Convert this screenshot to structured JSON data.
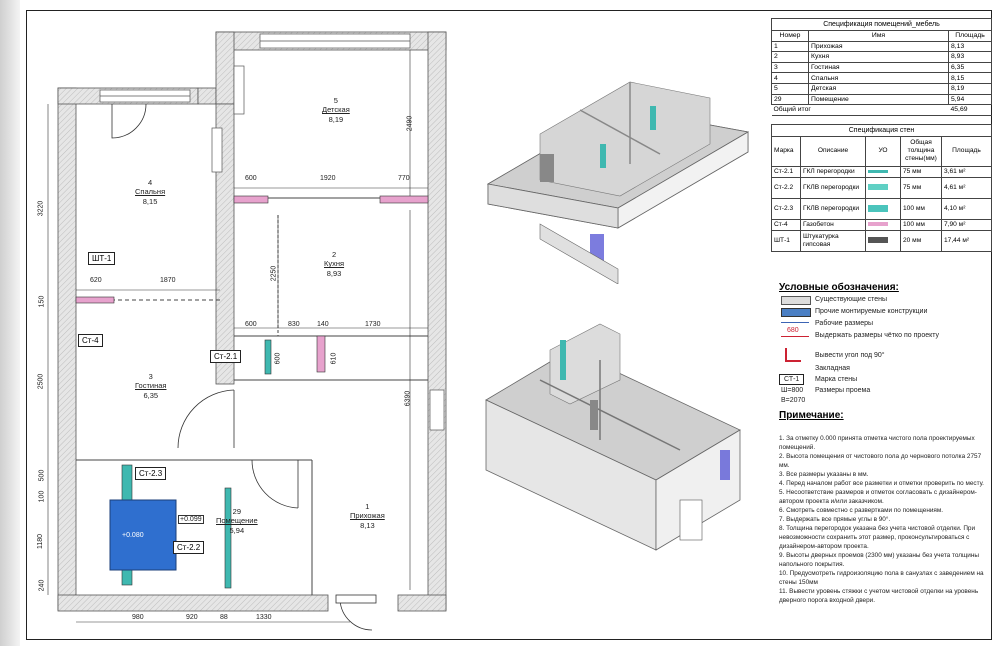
{
  "rooms": [
    {
      "num": "5",
      "name": "Детская",
      "area": "8,19"
    },
    {
      "num": "4",
      "name": "Спальня",
      "area": "8,15"
    },
    {
      "num": "2",
      "name": "Кухня",
      "area": "8,93"
    },
    {
      "num": "3",
      "name": "Гостиная",
      "area": "6,35"
    },
    {
      "num": "29",
      "name": "Помещение",
      "area": "5,94"
    },
    {
      "num": "1",
      "name": "Прихожая",
      "area": "8,13"
    }
  ],
  "dimensions": {
    "top_600": "600",
    "top_1920": "1920",
    "top_770": "770",
    "mid_600": "600",
    "mid_830": "830",
    "mid_140": "140",
    "mid_1730": "1730",
    "h_620": "620",
    "h_1870": "1870",
    "v_2490": "2490",
    "v_2250": "2250",
    "v_610": "610",
    "v_600": "600",
    "v_6390": "6390",
    "left_3220": "3220",
    "left_150": "150",
    "left_2500": "2500",
    "left_500": "500",
    "left_100": "100",
    "left_1180": "1180",
    "left_240": "240",
    "bot_980": "980",
    "bot_920": "920",
    "bot_88": "88",
    "bot_1330": "1330",
    "lvl_099": "+0.099",
    "lvl_080": "+0.080"
  },
  "wall_tags": {
    "sht1": "ШТ-1",
    "st4": "Ст-4",
    "st21": "Ст-2.1",
    "st23": "Ст-2.3",
    "st22": "Ст-2.2"
  },
  "room_spec": {
    "title": "Спецификация помещений_мебель",
    "headers": [
      "Номер",
      "Имя",
      "Площадь"
    ],
    "rows": [
      [
        "1",
        "Прихожая",
        "8,13"
      ],
      [
        "2",
        "Кухня",
        "8,93"
      ],
      [
        "3",
        "Гостиная",
        "6,35"
      ],
      [
        "4",
        "Спальня",
        "8,15"
      ],
      [
        "5",
        "Детская",
        "8,19"
      ],
      [
        "29",
        "Помещение",
        "5,94"
      ]
    ],
    "total_label": "Общий итог",
    "total_value": "45,69"
  },
  "wall_spec": {
    "title": "Спецификация стен",
    "headers": [
      "Марка",
      "Описание",
      "УО",
      "Общая толщина стены(мм)",
      "Площадь"
    ],
    "rows": [
      {
        "mark": "Ст-2.1",
        "desc": "ГКЛ перегородки",
        "thick": "75 мм",
        "area": "3,61 м²",
        "color": "#3fb8b0"
      },
      {
        "mark": "Ст-2.2",
        "desc": "ГКЛВ перегородки",
        "thick": "75 мм",
        "area": "4,61 м²",
        "color": "#5fd0c4"
      },
      {
        "mark": "Ст-2.3",
        "desc": "ГКЛВ перегородки",
        "thick": "100 мм",
        "area": "4,10 м²",
        "color": "#4bc4bc"
      },
      {
        "mark": "Ст-4",
        "desc": "Газобетон",
        "thick": "100 мм",
        "area": "7,90 м²",
        "color": "#e7a2cd"
      },
      {
        "mark": "ШТ-1",
        "desc": "Штукатурка гипсовая",
        "thick": "20 мм",
        "area": "17,44 м²",
        "color": "#555555"
      }
    ]
  },
  "legend": {
    "title": "Условные обозначения:",
    "items": {
      "existing": "Существующие стены",
      "other": "Прочие монтируемые конструкции",
      "work_dims": "Рабочие размеры",
      "sample_680": "680",
      "exact_dims": "Выдержать размеры чётко по проекту",
      "angle": "Вывести угол под 90°",
      "embed": "Закладная",
      "wall_mark": "Марка стены",
      "st1": "СТ-1",
      "opening_dims": "Размеры проема",
      "opening_w": "Ш=800",
      "opening_h": "В=2070"
    }
  },
  "notes": {
    "title": "Примечание:",
    "items": [
      "1. За отметку 0.000 принята отметка чистого пола проектируемых помещений.",
      "2. Высота помещения от чистового пола до чернового потолка 2757 мм.",
      "3. Все размеры указаны в мм.",
      "4. Перед началом работ все разметки и отметки проверить по месту.",
      "5. Несоответствие размеров и отметок согласовать с дизайнером-автором проекта и/или заказчиком.",
      "6. Смотреть совместно с развертками по помещениям.",
      "7. Выдержать все прямые углы в 90°.",
      "8. Толщина перегородок указана без учета чистовой отделки. При невозможности сохранить этот размер, проконсультироваться с дизайнером-автором проекта.",
      "9. Высоты дверных проемов (2300 мм) указаны без учета толщины напольного покрытия.",
      "10. Предусмотреть гидроизоляцию пола в санузлах с заведением на стены 150мм",
      "11. Вывести уровень стяжки с учетом чистовой отделки на уровень дверного порога входной двери."
    ]
  }
}
